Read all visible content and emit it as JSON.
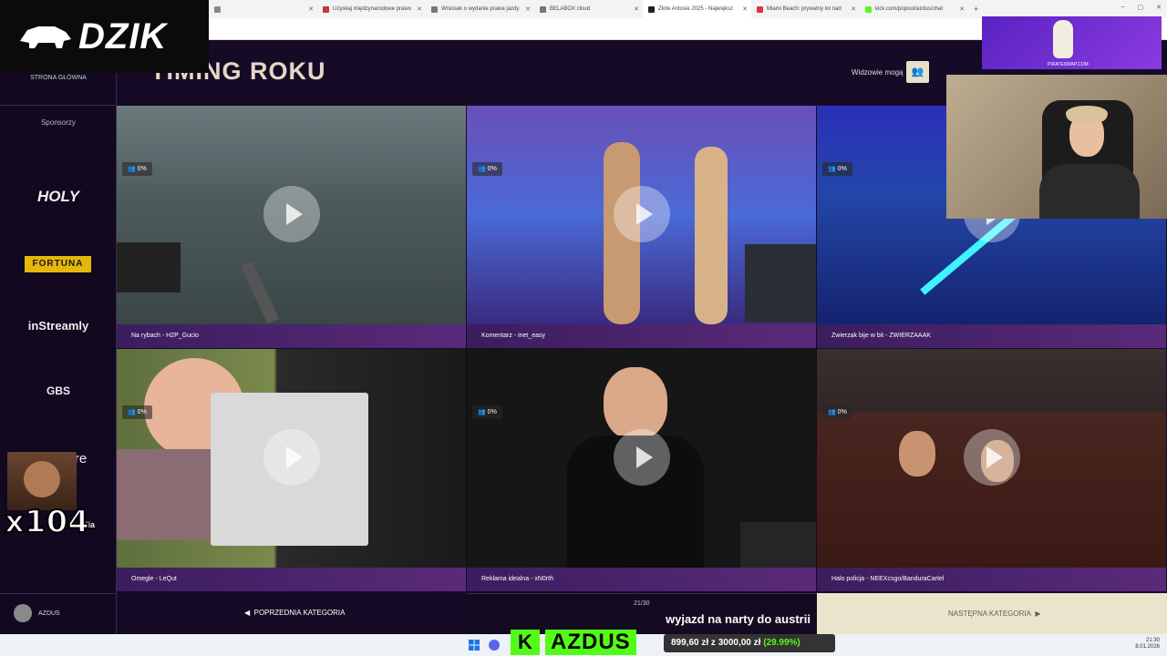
{
  "browser": {
    "tabs": [
      {
        "label": "",
        "color": "#888888"
      },
      {
        "label": "Uzyskaj międzynarodowe prawo",
        "color": "#cc3333"
      },
      {
        "label": "Wniosek o wydanie prawa jazdy",
        "color": "#777777"
      },
      {
        "label": "BELABOX cloud",
        "color": "#777777"
      },
      {
        "label": "Złote Antosie 2025 - Największ",
        "color": "#222222",
        "active": true
      },
      {
        "label": "Miami Beach: prywatny lot nad",
        "color": "#dd3344"
      },
      {
        "label": "kick.com/popout/azdus/chat",
        "color": "#53fc18"
      }
    ],
    "window_controls": [
      "–",
      "▢",
      "✕"
    ]
  },
  "logo": {
    "text": "DZIK"
  },
  "sidebar": {
    "home_label": "STRONA GŁÓWNA",
    "sponsors_label": "Sponsorzy",
    "sponsors": [
      "HOLY",
      "FORTUNA",
      "inStreamly",
      "GBS",
      "feat.store"
    ],
    "partial_text": "edia",
    "user": "AZDUS"
  },
  "emote": {
    "counter": "x104"
  },
  "header": {
    "title": "TIMING ROKU",
    "viewers_label": "Widzowie mogą"
  },
  "cards": [
    {
      "caption": "Na rybach - H2P_Gucio",
      "percent": "0%"
    },
    {
      "caption": "Komentarz - inet_easy",
      "percent": "0%"
    },
    {
      "caption": "Zwierzak bije w bit - ZWIERZAAAK",
      "percent": "0%"
    },
    {
      "caption": "Omegle - LeQut",
      "percent": "0%"
    },
    {
      "caption": "Reklama idealna - xN0rth",
      "percent": "0%"
    },
    {
      "caption": "Halo policja - NEEXcsgo/BanduraCartel",
      "percent": "0%"
    }
  ],
  "nav": {
    "prev": "POPRZEDNIA KATEGORIA",
    "counter": "21/30",
    "next": "NASTĘPNA KATEGORIA"
  },
  "overlay": {
    "duck_site": "PIRATESWAP.COM",
    "kick_letter": "K",
    "streamer": "AZDUS",
    "ski_text": "wyjazd na narty do austrii",
    "goal": "899,60 zł z 3000,00 zł",
    "goal_pct": "(29.99%)"
  },
  "taskbar": {
    "time": "21:30",
    "date": "8.01.2026"
  },
  "colors": {
    "accent_purple": "#5a2a7a",
    "kick_green": "#53fc18",
    "fortuna_yellow": "#e5b70a",
    "title_beige": "#e4d7c5"
  }
}
